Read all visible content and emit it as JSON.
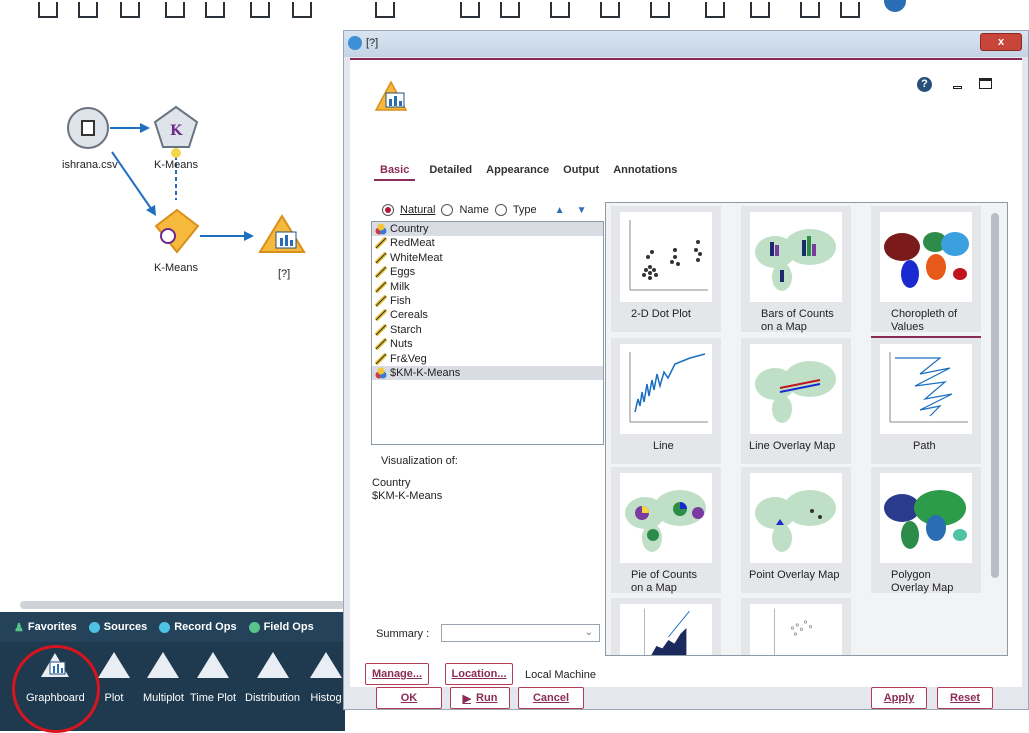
{
  "canvas": {
    "nodes": [
      {
        "label": "ishrana.csv"
      },
      {
        "label": "K-Means"
      },
      {
        "label": "K-Means"
      },
      {
        "label": "[?]"
      }
    ]
  },
  "palette": {
    "tabs": [
      "Favorites",
      "Sources",
      "Record Ops",
      "Field Ops"
    ],
    "items": [
      "Graphboard",
      "Plot",
      "Multiplot",
      "Time Plot",
      "Distribution",
      "Histog"
    ]
  },
  "dialog": {
    "title": "[?]",
    "close_label": "x",
    "help_label": "?",
    "tabs": [
      "Basic",
      "Detailed",
      "Appearance",
      "Output",
      "Annotations"
    ],
    "sort": {
      "natural": "Natural",
      "name": "Name",
      "type": "Type"
    },
    "fields": [
      {
        "name": "Country",
        "icon": "nominal-icon"
      },
      {
        "name": "RedMeat",
        "icon": "continuous-icon"
      },
      {
        "name": "WhiteMeat",
        "icon": "continuous-icon"
      },
      {
        "name": "Eggs",
        "icon": "continuous-icon"
      },
      {
        "name": "Milk",
        "icon": "continuous-icon"
      },
      {
        "name": "Fish",
        "icon": "continuous-icon"
      },
      {
        "name": "Cereals",
        "icon": "continuous-icon"
      },
      {
        "name": "Starch",
        "icon": "continuous-icon"
      },
      {
        "name": "Nuts",
        "icon": "continuous-icon"
      },
      {
        "name": "Fr&Veg",
        "icon": "continuous-icon"
      },
      {
        "name": "$KM-K-Means",
        "icon": "nominal-icon"
      }
    ],
    "viz_label": "Visualization of:",
    "viz_values": [
      "Country",
      "$KM-K-Means"
    ],
    "gallery": [
      {
        "l1": "2-D Dot Plot",
        "l2": ""
      },
      {
        "l1": "Bars of Counts",
        "l2": "on a Map"
      },
      {
        "l1": "Choropleth of",
        "l2": "Values"
      },
      {
        "l1": "Line",
        "l2": ""
      },
      {
        "l1": "Line Overlay Map",
        "l2": ""
      },
      {
        "l1": "Path",
        "l2": ""
      },
      {
        "l1": "Pie of Counts",
        "l2": "on a Map"
      },
      {
        "l1": "Point Overlay Map",
        "l2": ""
      },
      {
        "l1": "Polygon",
        "l2": "Overlay Map"
      }
    ],
    "summary_label": "Summary :",
    "manage_label": "Manage...",
    "location_label": "Location...",
    "location_value": "Local Machine",
    "ok_label": "OK",
    "run_label": "Run",
    "cancel_label": "Cancel",
    "apply_label": "Apply",
    "reset_label": "Reset"
  },
  "colors": {
    "accent": "#8a2c56",
    "palette_bg": "#1f3a4e",
    "highlight": "#d8141f"
  }
}
